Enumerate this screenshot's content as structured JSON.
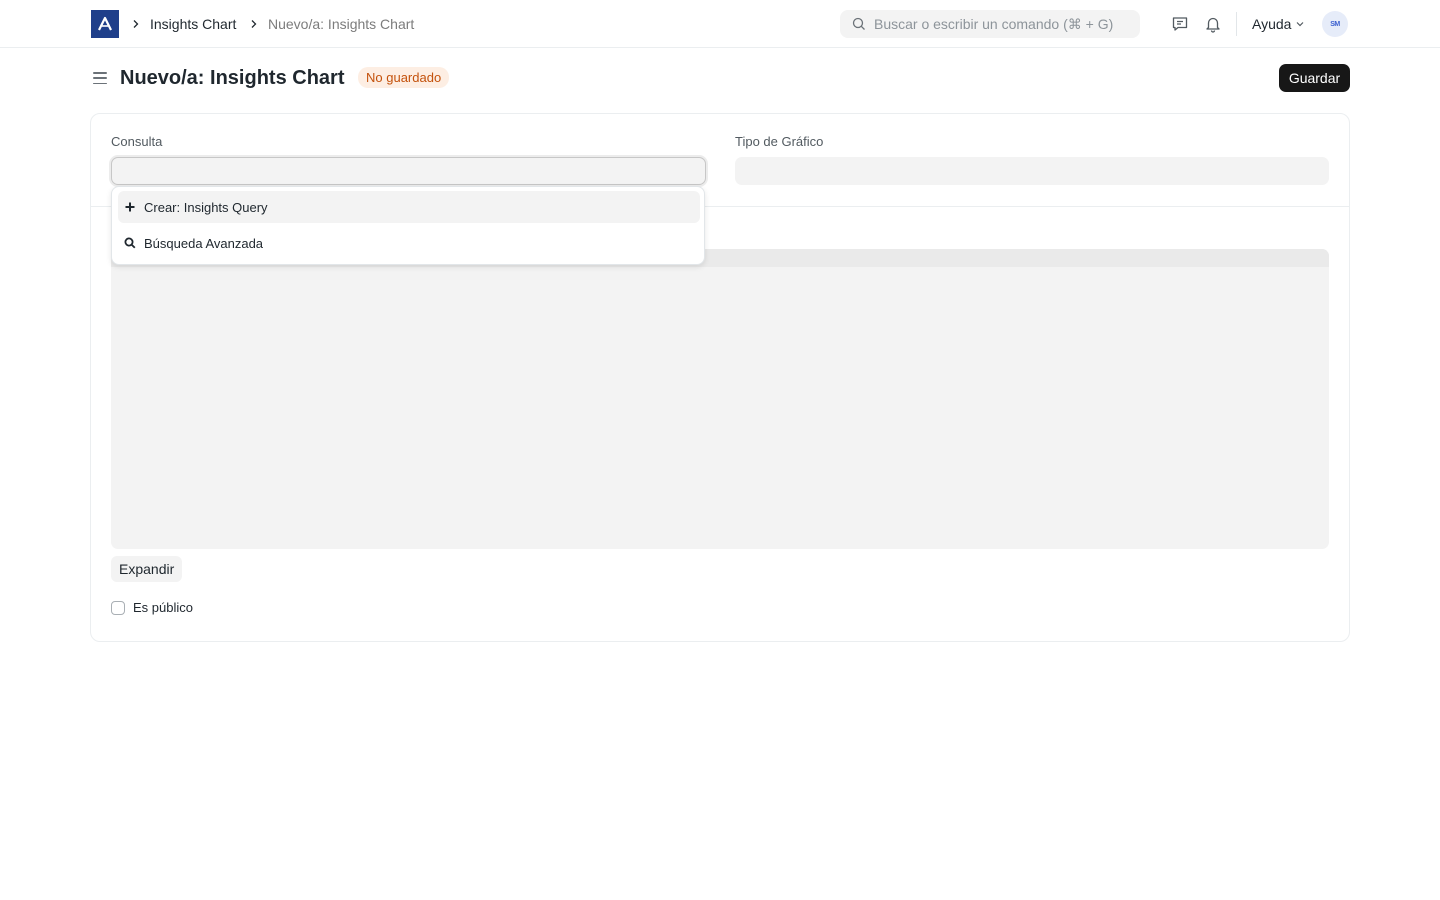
{
  "navbar": {
    "breadcrumbs": [
      "Insights Chart",
      "Nuevo/a: Insights Chart"
    ],
    "search": {
      "placeholder": "Buscar o escribir un comando (⌘ + G)",
      "value": ""
    },
    "help_label": "Ayuda",
    "avatar_initials": "SM",
    "icons": [
      "logo-icon",
      "chevron-right-icon",
      "search-icon",
      "chat-icon",
      "bell-icon",
      "chevron-down-icon"
    ]
  },
  "page": {
    "title": "Nuevo/a: Insights Chart",
    "status_badge": "No guardado",
    "save_label": "Guardar"
  },
  "form": {
    "fields": {
      "query": {
        "label": "Consulta",
        "value": ""
      },
      "chart_type": {
        "label": "Tipo de Gráfico",
        "value": ""
      }
    },
    "expand_label": "Expandir",
    "is_public": {
      "label": "Es público",
      "checked": false
    }
  },
  "dropdown": {
    "items": [
      {
        "label": "Crear: Insights Query",
        "icon": "plus-icon"
      },
      {
        "label": "Búsqueda Avanzada",
        "icon": "search-icon"
      }
    ]
  },
  "colors": {
    "brand": "#1f3f8a",
    "primary_button": "#171717",
    "badge_bg": "#fdeee3",
    "badge_text": "#c4520c",
    "input_bg": "#f3f3f3"
  }
}
